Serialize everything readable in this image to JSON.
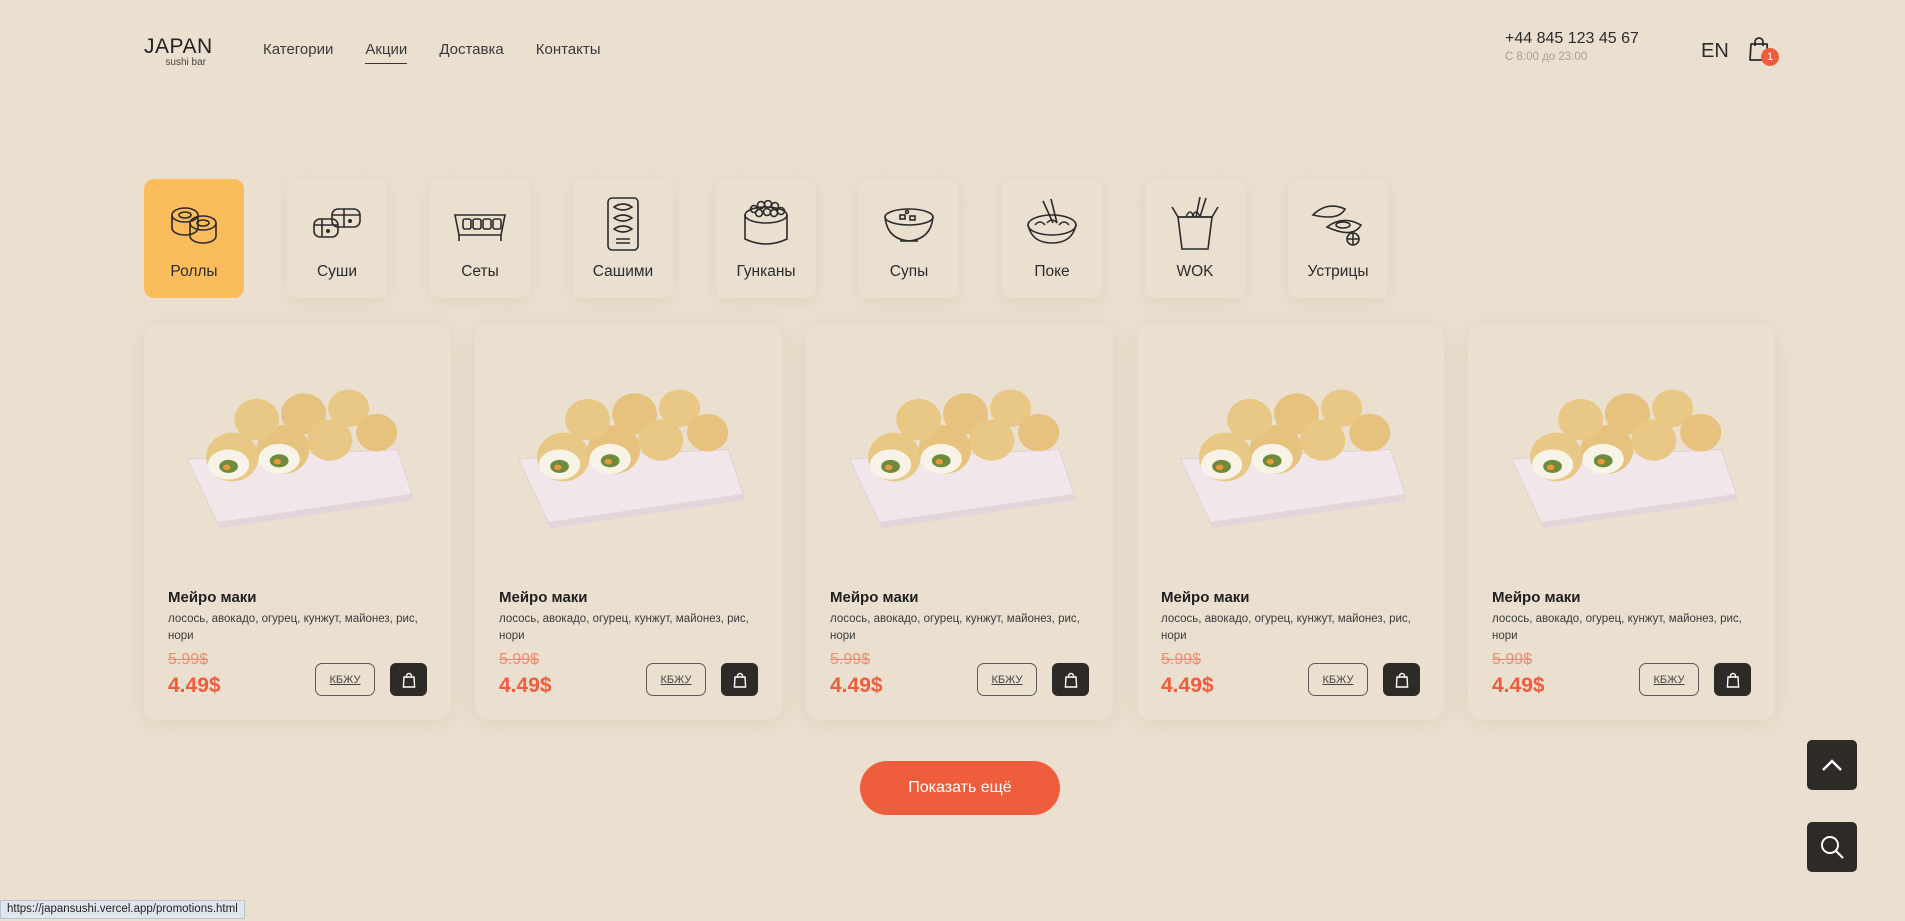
{
  "logo": {
    "main": "JAPAN",
    "sub": "sushi bar"
  },
  "nav": {
    "items": [
      {
        "label": "Категории"
      },
      {
        "label": "Акции",
        "active": true
      },
      {
        "label": "Доставка"
      },
      {
        "label": "Контакты"
      }
    ]
  },
  "contact": {
    "phone": "+44 845 123 45 67",
    "hours": "С 8:00 до 23:00"
  },
  "lang": "EN",
  "cart": {
    "icon": "shopping-bag-icon",
    "count": "1",
    "badge_color": "#ee5d3c"
  },
  "categories": [
    {
      "label": "Роллы",
      "icon": "rolls-icon",
      "active": true
    },
    {
      "label": "Суши",
      "icon": "sushi-icon"
    },
    {
      "label": "Сеты",
      "icon": "sets-icon"
    },
    {
      "label": "Сашими",
      "icon": "sashimi-icon"
    },
    {
      "label": "Гунканы",
      "icon": "gunkan-icon"
    },
    {
      "label": "Супы",
      "icon": "soup-icon"
    },
    {
      "label": "Поке",
      "icon": "poke-icon"
    },
    {
      "label": "WOK",
      "icon": "wok-icon"
    },
    {
      "label": "Устрицы",
      "icon": "oysters-icon"
    }
  ],
  "products": [
    {
      "name": "Мейро маки",
      "description": "лосось, авокадо, огурец, кунжут, майонез, рис, нори",
      "old_price": "5.99$",
      "price": "4.49$",
      "kbju": "КБЖУ"
    },
    {
      "name": "Мейро маки",
      "description": "лосось, авокадо, огурец, кунжут, майонез, рис, нори",
      "old_price": "5.99$",
      "price": "4.49$",
      "kbju": "КБЖУ"
    },
    {
      "name": "Мейро маки",
      "description": "лосось, авокадо, огурец, кунжут, майонез, рис, нори",
      "old_price": "5.99$",
      "price": "4.49$",
      "kbju": "КБЖУ"
    },
    {
      "name": "Мейро маки",
      "description": "лосось, авокадо, огурец, кунжут, майонез, рис, нори",
      "old_price": "5.99$",
      "price": "4.49$",
      "kbju": "КБЖУ"
    },
    {
      "name": "Мейро маки",
      "description": "лосось, авокадо, огурец, кунжут, майонез, рис, нори",
      "old_price": "5.99$",
      "price": "4.49$",
      "kbju": "КБЖУ"
    }
  ],
  "show_more": "Показать ещё",
  "fab": {
    "up_icon": "chevron-up-icon",
    "search_icon": "search-icon"
  },
  "status_url": "https://japansushi.vercel.app/promotions.html",
  "colors": {
    "background": "#ebe0d0",
    "accent": "#ee5d3c",
    "active_category": "#fbbd5c",
    "dark": "#2d2a28"
  }
}
